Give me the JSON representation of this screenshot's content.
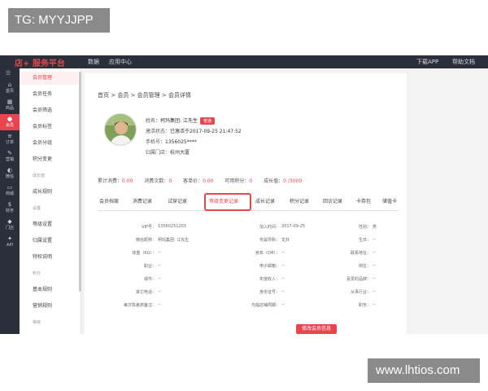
{
  "watermarks": {
    "top": "TG: MYYJJPP",
    "bottom": "www.lhtios.com"
  },
  "topbar": {
    "brand": "店+ 服务平台",
    "nav": [
      "数据",
      "应用中心"
    ],
    "right": [
      "下载APP",
      "帮助文档"
    ]
  },
  "sidenav": [
    {
      "label": "首页",
      "icon": "home-icon",
      "glyph": "⌂",
      "active": false
    },
    {
      "label": "商品",
      "icon": "goods-icon",
      "glyph": "▦",
      "active": false
    },
    {
      "label": "会员",
      "icon": "member-icon",
      "glyph": "●",
      "active": true
    },
    {
      "label": "订单",
      "icon": "order-icon",
      "glyph": "≡",
      "active": false
    },
    {
      "label": "营销",
      "icon": "marketing-icon",
      "glyph": "✎",
      "active": false
    },
    {
      "label": "微信",
      "icon": "wechat-icon",
      "glyph": "◐",
      "active": false
    },
    {
      "label": "商城",
      "icon": "mall-icon",
      "glyph": "▭",
      "active": false
    },
    {
      "label": "财务",
      "icon": "finance-icon",
      "glyph": "$",
      "active": false
    },
    {
      "label": "门店",
      "icon": "store-icon",
      "glyph": "◆",
      "active": false
    },
    {
      "label": "API",
      "icon": "api-icon",
      "glyph": "✦",
      "active": false
    }
  ],
  "submenu": [
    {
      "label": "会员管理",
      "type": "item",
      "active": true
    },
    {
      "label": "会员任务",
      "type": "item",
      "active": false
    },
    {
      "label": "会员筛选",
      "type": "item",
      "active": false
    },
    {
      "label": "会员标签",
      "type": "item",
      "active": false
    },
    {
      "label": "会员分组",
      "type": "item",
      "active": false
    },
    {
      "label": "积分变更",
      "type": "item",
      "active": false
    },
    {
      "label": "成长值",
      "type": "group",
      "active": false
    },
    {
      "label": "成长规则",
      "type": "item",
      "active": false
    },
    {
      "label": "设置",
      "type": "group",
      "active": false
    },
    {
      "label": "等级设置",
      "type": "item",
      "active": false
    },
    {
      "label": "归属设置",
      "type": "item",
      "active": false
    },
    {
      "label": "特权说明",
      "type": "item",
      "active": false
    },
    {
      "label": "积分",
      "type": "group",
      "active": false
    },
    {
      "label": "基本规则",
      "type": "item",
      "active": false
    },
    {
      "label": "营销规则",
      "type": "item",
      "active": false
    },
    {
      "label": "等级",
      "type": "group",
      "active": false
    }
  ],
  "breadcrumb": "首页 > 会员 > 会员管理 > 会员详情",
  "member": {
    "name_label": "姓名：",
    "name_value": "柯玛集团: 江先生",
    "badge": "普通",
    "status_label": "激活状态：",
    "status_value": "已激活于2017-09-25 21:47:52",
    "phone_label": "手机号：",
    "phone_value": "1356025****",
    "store_label": "归属门店：",
    "store_value": "杭州大厦"
  },
  "stats": [
    {
      "label": "累计消费：",
      "value": "0.00"
    },
    {
      "label": "消费次数：",
      "value": "0"
    },
    {
      "label": "客单价：",
      "value": "0.00"
    },
    {
      "label": "可用积分：",
      "value": "0"
    },
    {
      "label": "成长值：",
      "value": "0 /3000"
    }
  ],
  "tabs": [
    "会员档案",
    "消费记录",
    "试穿记录",
    "等级变更记录",
    "成长记录",
    "积分记录",
    "回访记录",
    "卡券包",
    "储值卡"
  ],
  "active_tab": 3,
  "profile_fields": {
    "left": [
      {
        "label": "VIP号：",
        "value": "13560251203"
      },
      {
        "label": "微信昵称：",
        "value": "柯玛集团: 江先生"
      },
      {
        "label": "体重（KG）：",
        "value": "--"
      },
      {
        "label": "职业：",
        "value": "--"
      },
      {
        "label": "城市：",
        "value": "--"
      },
      {
        "label": "其它电话：",
        "value": "--"
      },
      {
        "label": "每次陈差旅备注：",
        "value": "--"
      }
    ],
    "middle": [
      {
        "label": "加入时间：",
        "value": "2017-09-25"
      },
      {
        "label": "专属导购：",
        "value": "龙井"
      },
      {
        "label": "身高（CM）：",
        "value": "--"
      },
      {
        "label": "电子邮箱：",
        "value": "--"
      },
      {
        "label": "年度收入：",
        "value": "--"
      },
      {
        "label": "身份证号：",
        "value": "--"
      },
      {
        "label": "光临店铺周期：",
        "value": "--"
      }
    ],
    "right": [
      {
        "label": "性别：",
        "value": "男"
      },
      {
        "label": "生日：",
        "value": "--"
      },
      {
        "label": "联系地址：",
        "value": "--"
      },
      {
        "label": "岗位：",
        "value": "--"
      },
      {
        "label": "喜爱的品牌：",
        "value": "--"
      },
      {
        "label": "从事行业：",
        "value": "--"
      },
      {
        "label": "职务：",
        "value": "--"
      }
    ]
  },
  "edit_button": "修改会员信息",
  "colors": {
    "accent": "#e8454e",
    "sidebar": "#2b2f3a"
  }
}
